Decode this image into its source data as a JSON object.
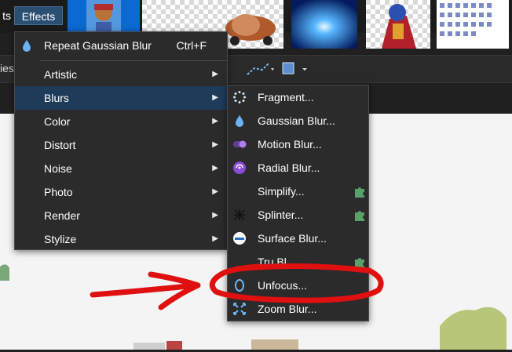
{
  "menubar": {
    "left_item": "ts",
    "effects": "Effects",
    "side_label": "ies"
  },
  "effects_menu": {
    "repeat": {
      "label": "Repeat Gaussian Blur",
      "shortcut": "Ctrl+F"
    },
    "items": [
      {
        "label": "Artistic"
      },
      {
        "label": "Blurs"
      },
      {
        "label": "Color"
      },
      {
        "label": "Distort"
      },
      {
        "label": "Noise"
      },
      {
        "label": "Photo"
      },
      {
        "label": "Render"
      },
      {
        "label": "Stylize"
      }
    ]
  },
  "blurs_menu": {
    "items": [
      {
        "label": "Fragment...",
        "icon": "fragment-icon"
      },
      {
        "label": "Gaussian Blur...",
        "icon": "droplet-icon"
      },
      {
        "label": "Motion Blur...",
        "icon": "motion-blur-icon"
      },
      {
        "label": "Radial Blur...",
        "icon": "radial-blur-icon"
      },
      {
        "label": "Simplify...",
        "icon": "plugin-icon"
      },
      {
        "label": "Splinter...",
        "icon": "splinter-icon"
      },
      {
        "label": "Surface Blur...",
        "icon": "surface-blur-icon"
      },
      {
        "label": "Tru Bl...",
        "icon": "plugin-icon"
      },
      {
        "label": "Unfocus...",
        "icon": "unfocus-icon"
      },
      {
        "label": "Zoom Blur...",
        "icon": "zoom-blur-icon"
      }
    ]
  },
  "annotation": {
    "color": "#e01010"
  },
  "colors": {
    "menu_bg": "#2b2b2b",
    "highlight": "#1f3b5a",
    "plugin_green": "#5aa06a",
    "icon_blue": "#6db3f2"
  }
}
